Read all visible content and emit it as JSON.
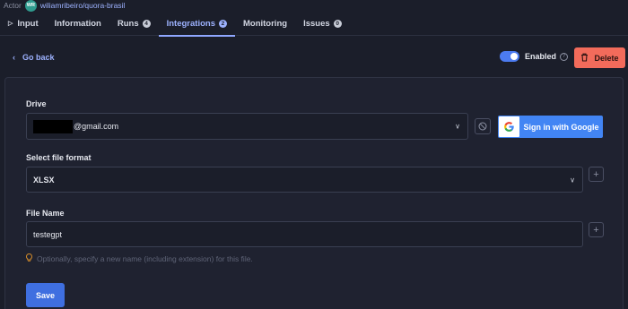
{
  "header": {
    "actor_label": "Actor",
    "avatar_initials": "WR",
    "actor_path": "wiliamribeiro/quora-brasil"
  },
  "tabs": [
    {
      "label": "Input",
      "badge": null
    },
    {
      "label": "Information",
      "badge": null
    },
    {
      "label": "Runs",
      "badge": "4"
    },
    {
      "label": "Integrations",
      "badge": "2",
      "active": true
    },
    {
      "label": "Monitoring",
      "badge": null
    },
    {
      "label": "Issues",
      "badge": "0"
    }
  ],
  "toolbar": {
    "go_back": "Go back",
    "enabled_label": "Enabled",
    "enabled": true,
    "delete_label": "Delete"
  },
  "form": {
    "drive": {
      "label": "Drive",
      "value": "@gmail.com",
      "google_button": "Sign in with Google"
    },
    "file_format": {
      "label": "Select file format",
      "value": "XLSX"
    },
    "file_name": {
      "label": "File Name",
      "value": "testegpt",
      "hint": "Optionally, specify a new name (including extension) for this file."
    },
    "save_label": "Save"
  },
  "colors": {
    "background": "#1b1e2a",
    "accent": "#9db2ff",
    "toggle": "#4c7bf0",
    "delete": "#f26b5b",
    "google": "#4285f4",
    "save": "#3f6fe0"
  }
}
